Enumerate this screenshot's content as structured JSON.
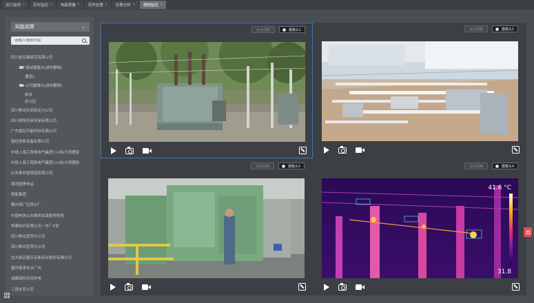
{
  "tabs": [
    {
      "label": "运行监视",
      "active": false
    },
    {
      "label": "实时监控",
      "active": false
    },
    {
      "label": "电能质量",
      "active": false
    },
    {
      "label": "实时告警",
      "active": false
    },
    {
      "label": "告警分析",
      "active": false
    },
    {
      "label": "视频监控",
      "active": true
    }
  ],
  "sidebar": {
    "selector_label": "知能视算",
    "search_placeholder": "请输入搜索内容",
    "items": [
      {
        "label": "四川省住建研究有限公司",
        "level": 0
      },
      {
        "label": "测试摄像头(请勿删除)",
        "level": 1,
        "icon": "camera-icon"
      },
      {
        "label": "通道1",
        "level": 2
      },
      {
        "label": "公司摄像头(请勿删除)",
        "level": 1,
        "icon": "camera-icon"
      },
      {
        "label": "前台",
        "level": 2
      },
      {
        "label": "办公区",
        "level": 2
      },
      {
        "label": "四川移动天府新区分公司",
        "level": 0
      },
      {
        "label": "四川锐阳乐英安装有限公司",
        "level": 0
      },
      {
        "label": "广东鑫钻节能科技有限公司",
        "level": 0
      },
      {
        "label": "智控创新设备有限公司",
        "level": 0
      },
      {
        "label": "中铁上海工程局电气集团TJ-6标大项理部",
        "level": 0
      },
      {
        "label": "中铁上海工程局电气集团TJ-6标大项理部",
        "level": 0
      },
      {
        "label": "山东泰安智慧园有限公司",
        "level": 0
      },
      {
        "label": "璟浩园寄电站",
        "level": 0
      },
      {
        "label": "局能集团",
        "level": 0
      },
      {
        "label": "蜀州锦厂区段分厂",
        "level": 0
      },
      {
        "label": "中国电信山东维修支采服务机构",
        "level": 0
      },
      {
        "label": "恒泰纺织有限公司一东厂P变",
        "level": 0
      },
      {
        "label": "四川移动宜宾分公司",
        "level": 0
      },
      {
        "label": "四川移动宜宾分公司",
        "level": 0
      },
      {
        "label": "龙大新苏嘉庆无新药业股份有限公司",
        "level": 0
      },
      {
        "label": "嘉祥县净化水厂内",
        "level": 0
      },
      {
        "label": "成都瑞科光伏供电",
        "level": 0
      },
      {
        "label": "三良水泥公司",
        "level": 0
      }
    ]
  },
  "video_cells": [
    {
      "control_label": "云台控制",
      "camera_label": "摄像头1",
      "scene": "substation",
      "selected": true
    },
    {
      "control_label": "云台控制",
      "camera_label": "摄像头2",
      "scene": "factory-line",
      "selected": false
    },
    {
      "control_label": "云台控制",
      "camera_label": "摄像头3",
      "scene": "machine-workshop",
      "selected": false
    },
    {
      "control_label": "云台控制",
      "camera_label": "摄像头4",
      "scene": "thermal",
      "selected": false,
      "thermal_max": "41.6 °C",
      "thermal_min": "31.8"
    }
  ],
  "colors": {
    "accent_border": "#3d74b8",
    "float_button": "#e0505a"
  }
}
